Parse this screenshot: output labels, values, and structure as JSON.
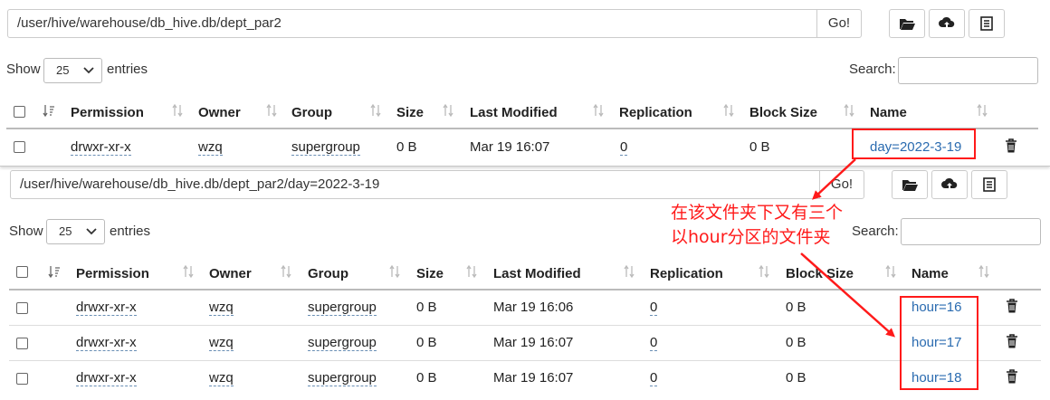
{
  "colors": {
    "annotation": "#ff1a1a",
    "link": "#2a6bb0",
    "topbar": "#2e8b3a"
  },
  "panel1": {
    "path": "/user/hive/warehouse/db_hive.db/dept_par2",
    "go_label": "Go!",
    "show_label": "Show",
    "entries_value": "25",
    "entries_label": "entries",
    "search_label": "Search:",
    "headers": [
      "Permission",
      "Owner",
      "Group",
      "Size",
      "Last Modified",
      "Replication",
      "Block Size",
      "Name"
    ],
    "rows": [
      {
        "permission": "drwxr-xr-x",
        "owner": "wzq",
        "group": "supergroup",
        "size": "0 B",
        "modified": "Mar 19 16:07",
        "replication": "0",
        "block_size": "0 B",
        "name": "day=2022-3-19"
      }
    ]
  },
  "panel2": {
    "path": "/user/hive/warehouse/db_hive.db/dept_par2/day=2022-3-19",
    "go_label": "Go!",
    "show_label": "Show",
    "entries_value": "25",
    "entries_label": "entries",
    "search_label": "Search:",
    "headers": [
      "Permission",
      "Owner",
      "Group",
      "Size",
      "Last Modified",
      "Replication",
      "Block Size",
      "Name"
    ],
    "rows": [
      {
        "permission": "drwxr-xr-x",
        "owner": "wzq",
        "group": "supergroup",
        "size": "0 B",
        "modified": "Mar 19 16:06",
        "replication": "0",
        "block_size": "0 B",
        "name": "hour=16"
      },
      {
        "permission": "drwxr-xr-x",
        "owner": "wzq",
        "group": "supergroup",
        "size": "0 B",
        "modified": "Mar 19 16:07",
        "replication": "0",
        "block_size": "0 B",
        "name": "hour=17"
      },
      {
        "permission": "drwxr-xr-x",
        "owner": "wzq",
        "group": "supergroup",
        "size": "0 B",
        "modified": "Mar 19 16:07",
        "replication": "0",
        "block_size": "0 B",
        "name": "hour=18"
      }
    ]
  },
  "annotation": {
    "line1": "在该文件夹下又有三个",
    "line2": "以hour分区的文件夹"
  },
  "icons": [
    "folder-open-icon",
    "upload-cloud-icon",
    "list-icon",
    "sort-icon",
    "sort-asc-icon",
    "trash-icon",
    "chevron-down-icon"
  ]
}
